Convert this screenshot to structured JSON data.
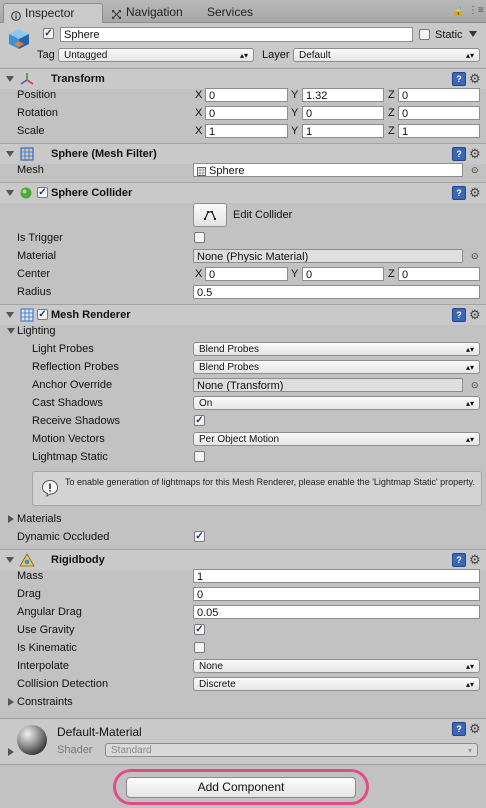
{
  "tabs": {
    "inspector": "Inspector",
    "navigation": "Navigation",
    "services": "Services"
  },
  "object": {
    "name": "Sphere",
    "static_label": "Static",
    "tag_label": "Tag",
    "tag_value": "Untagged",
    "layer_label": "Layer",
    "layer_value": "Default",
    "active": true
  },
  "transform": {
    "title": "Transform",
    "position": {
      "label": "Position",
      "x": "0",
      "y": "1.32",
      "z": "0"
    },
    "rotation": {
      "label": "Rotation",
      "x": "0",
      "y": "0",
      "z": "0"
    },
    "scale": {
      "label": "Scale",
      "x": "1",
      "y": "1",
      "z": "1"
    }
  },
  "axes": {
    "x": "X",
    "y": "Y",
    "z": "Z"
  },
  "mesh_filter": {
    "title": "Sphere (Mesh Filter)",
    "mesh_label": "Mesh",
    "mesh_value": "Sphere"
  },
  "sphere_collider": {
    "title": "Sphere Collider",
    "edit_label": "Edit Collider",
    "is_trigger_label": "Is Trigger",
    "is_trigger": false,
    "material_label": "Material",
    "material_value": "None (Physic Material)",
    "center_label": "Center",
    "center": {
      "x": "0",
      "y": "0",
      "z": "0"
    },
    "radius_label": "Radius",
    "radius_value": "0.5"
  },
  "mesh_renderer": {
    "title": "Mesh Renderer",
    "lighting_label": "Lighting",
    "light_probes_label": "Light Probes",
    "light_probes_value": "Blend Probes",
    "reflection_probes_label": "Reflection Probes",
    "reflection_probes_value": "Blend Probes",
    "anchor_override_label": "Anchor Override",
    "anchor_override_value": "None (Transform)",
    "cast_shadows_label": "Cast Shadows",
    "cast_shadows_value": "On",
    "receive_shadows_label": "Receive Shadows",
    "receive_shadows": true,
    "motion_vectors_label": "Motion Vectors",
    "motion_vectors_value": "Per Object Motion",
    "lightmap_static_label": "Lightmap Static",
    "lightmap_static": false,
    "info_text": "To enable generation of lightmaps for this Mesh Renderer, please enable the 'Lightmap Static' property.",
    "materials_label": "Materials",
    "dynamic_occluded_label": "Dynamic Occluded",
    "dynamic_occluded": true
  },
  "rigidbody": {
    "title": "Rigidbody",
    "mass_label": "Mass",
    "mass_value": "1",
    "drag_label": "Drag",
    "drag_value": "0",
    "angular_drag_label": "Angular Drag",
    "angular_drag_value": "0.05",
    "use_gravity_label": "Use Gravity",
    "use_gravity": true,
    "is_kinematic_label": "Is Kinematic",
    "is_kinematic": false,
    "interpolate_label": "Interpolate",
    "interpolate_value": "None",
    "collision_detection_label": "Collision Detection",
    "collision_detection_value": "Discrete",
    "constraints_label": "Constraints"
  },
  "material": {
    "name": "Default-Material",
    "shader_label": "Shader",
    "shader_value": "Standard"
  },
  "add_component_label": "Add Component",
  "colors": {
    "highlight": "#e04e8a",
    "help": "#3c67b7",
    "check": "#1f3a76"
  }
}
